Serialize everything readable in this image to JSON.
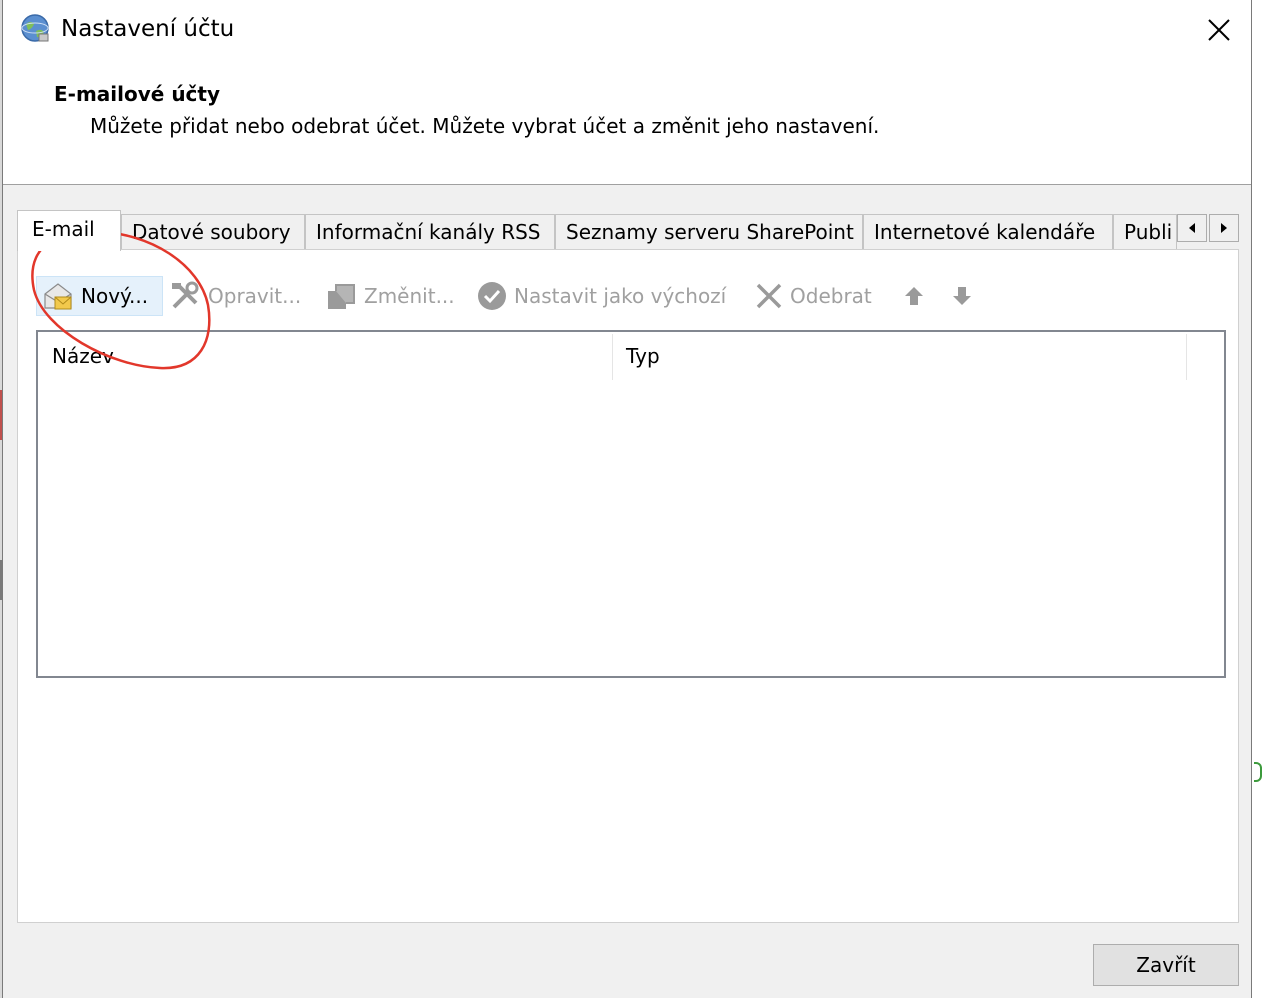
{
  "window": {
    "title": "Nastavení účtu",
    "close_icon": "close-icon",
    "app_icon": "globe-icon"
  },
  "header": {
    "section_title": "E-mailové účty",
    "description": "Můžete přidat nebo odebrat účet. Můžete vybrat účet a změnit jeho nastavení."
  },
  "tabs": [
    {
      "label": "E-mail",
      "active": true
    },
    {
      "label": "Datové soubory"
    },
    {
      "label": "Informační kanály RSS"
    },
    {
      "label": "Seznamy serveru SharePoint"
    },
    {
      "label": "Internetové kalendáře"
    },
    {
      "label": "Publi"
    }
  ],
  "toolbar": {
    "new": "Nový...",
    "repair": "Opravit...",
    "change": "Změnit...",
    "set_default": "Nastavit jako výchozí",
    "remove": "Odebrat"
  },
  "list": {
    "columns": [
      "Název",
      "Typ"
    ]
  },
  "footer": {
    "close_label": "Zavřít"
  },
  "colors": {
    "annotation": "#e2372b",
    "hover_bg": "#e5f1fb",
    "disabled_text": "#a0a0a0"
  }
}
